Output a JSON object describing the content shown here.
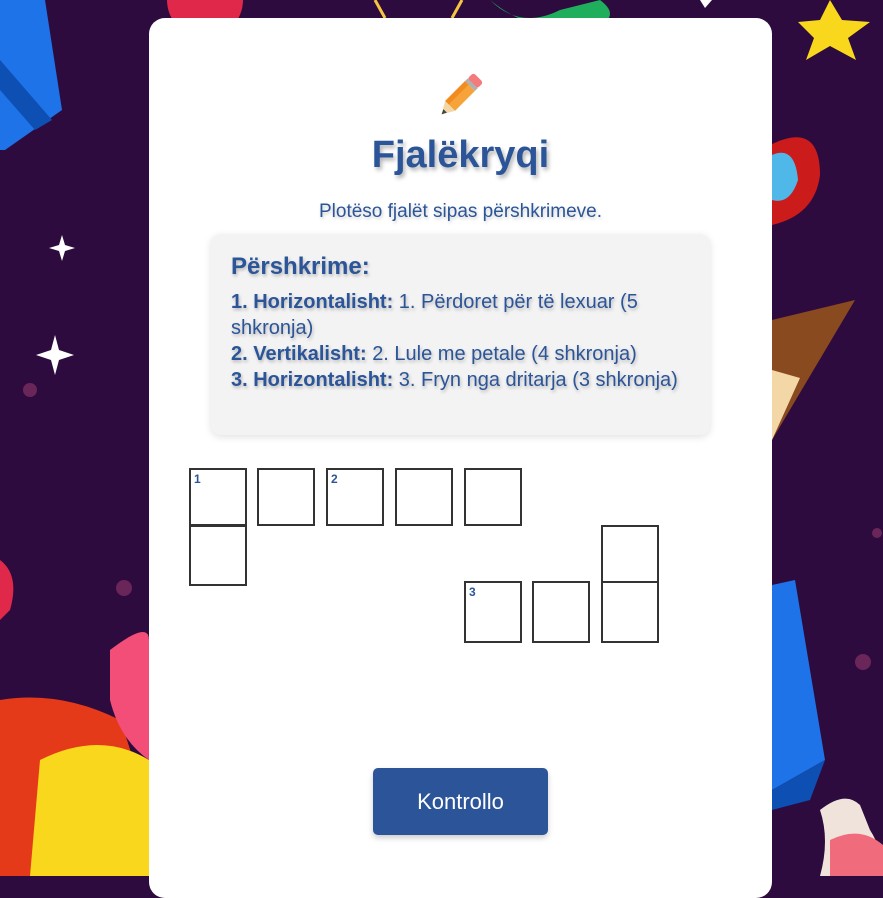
{
  "game": {
    "title": "Fjalëkryqi",
    "subtitle": "Plotëso fjalët sipas përshkrimeve.",
    "pencil_icon": "pencil-icon"
  },
  "clues": {
    "heading": "Përshkrime:",
    "items": [
      {
        "label": "1. Horizontalisht:",
        "text": "1. Përdoret për të lexuar (5 shkronja)"
      },
      {
        "label": "2. Vertikalisht:",
        "text": "2. Lule me petale (4 shkronja)"
      },
      {
        "label": "3. Horizontalisht:",
        "text": "3. Fryn nga dritarja (3 shkronja)"
      }
    ]
  },
  "grid": {
    "numbers": [
      "1",
      "2",
      "3"
    ]
  },
  "check_button": {
    "label": "Kontrollo"
  },
  "colors": {
    "accent": "#2b5598",
    "background": "#2e0b3e",
    "card": "#ffffff"
  }
}
